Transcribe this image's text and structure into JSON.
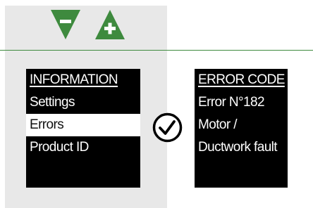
{
  "toolbar": {
    "minus_icon": "triangle-down-minus",
    "plus_icon": "triangle-up-plus",
    "button_color": "#3e8a3e"
  },
  "menu": {
    "title": "INFORMATION",
    "items": [
      {
        "label": "Settings",
        "selected": false
      },
      {
        "label": "Errors",
        "selected": true
      },
      {
        "label": "Product ID",
        "selected": false
      }
    ]
  },
  "confirm_icon": "check-circle-icon",
  "error_panel": {
    "title": "ERROR CODE",
    "code": "Error N°182",
    "description_line1": "Motor /",
    "description_line2": "Ductwork fault"
  }
}
